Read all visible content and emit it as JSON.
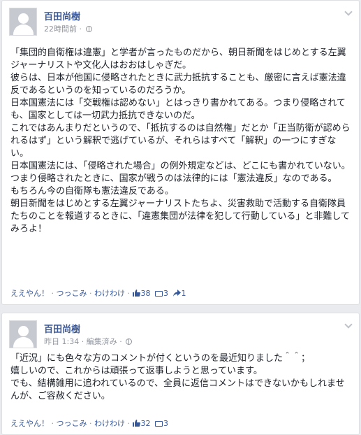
{
  "posts": [
    {
      "author": "百田尚樹",
      "time": "22時間前",
      "edited": "",
      "paragraphs": [
        "「集団的自衛権は違憲」と学者が言ったものだから、朝日新聞をはじめとする左翼ジャーナリストや文化人はおおはしゃぎだ。",
        "彼らは、日本が他国に侵略されたときに武力抵抗することも、厳密に言えば憲法違反であるというのを知っているのだろうか。",
        "日本国憲法には「交戦権は認めない」とはっきり書かれてある。つまり侵略されても、国家としては一切武力抵抗できないのだ。",
        "これではあんまりだというので、「抵抗するのは自然権」だとか「正当防衛が認められるはず」という解釈で逃げているが、それらはすべて「解釈」の一つにすぎない。",
        "日本国憲法には、「侵略された場合」の例外規定などは、どこにも書かれていない。",
        "つまり侵略されたときに、国家が戦うのは法律的には「憲法違反」なのである。",
        "もちろん今の自衛隊も憲法違反である。",
        "朝日新聞をはじめとする左翼ジャーナリストたちよ、災害救助で活動する自衛隊員たちのことを報道するときに、「違憲集団が法律を犯して行動している」と非難してみろよ！"
      ],
      "actions": [
        "ええやん！",
        "つっこみ",
        "わけわけ"
      ],
      "likes": "38",
      "comments": "3",
      "shares": "1"
    },
    {
      "author": "百田尚樹",
      "time": "昨日 1:34",
      "edited": "編集済み",
      "paragraphs": [
        "「近況」にも色々な方のコメントが付くというのを最近知りました＾＾；",
        "嬉しいので、これからは頑張って返事しようと思っています。",
        "でも、結構雑用に追われているので、全員に返信コメントはできないかもしれませんが、ご容赦ください。"
      ],
      "actions": [
        "ええやん！",
        "つっこみ",
        "わけわけ"
      ],
      "likes": "32",
      "comments": "3"
    }
  ],
  "colors": {
    "link": "#3b5998",
    "action": "#365899",
    "meta": "#90949c",
    "background": "#e9ebee"
  },
  "icons": [
    "globe-icon",
    "chevron-down-icon",
    "like-icon",
    "comment-icon",
    "share-icon"
  ]
}
